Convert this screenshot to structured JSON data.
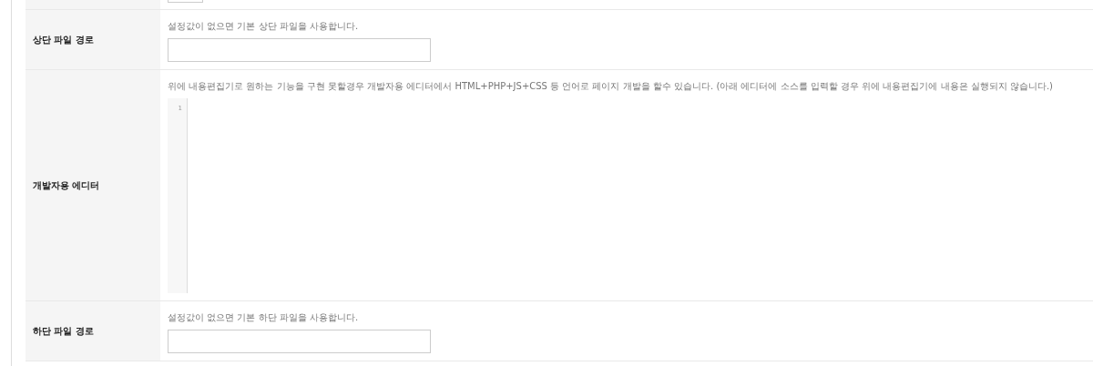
{
  "rows": [
    {
      "kind": "text",
      "label": "상단 파일 경로",
      "help": "설정값이 없으면 기본 상단 파일을 사용합니다.",
      "value": ""
    },
    {
      "kind": "editor",
      "label": "개발자용 에디터",
      "help": "위에 내용편집기로 원하는 기능을 구현 못할경우 개발자용 에디터에서 HTML+PHP+JS+CSS 등 언어로 페이지 개발을 할수 있습니다. (아래 에디터에 소스를 입력할 경우 위에 내용편집기에 내용은 실행되지 않습니다.)",
      "line_numbers": [
        "1"
      ]
    },
    {
      "kind": "text",
      "label": "하단 파일 경로",
      "help": "설정값이 없으면 기본 하단 파일을 사용합니다.",
      "value": ""
    }
  ]
}
